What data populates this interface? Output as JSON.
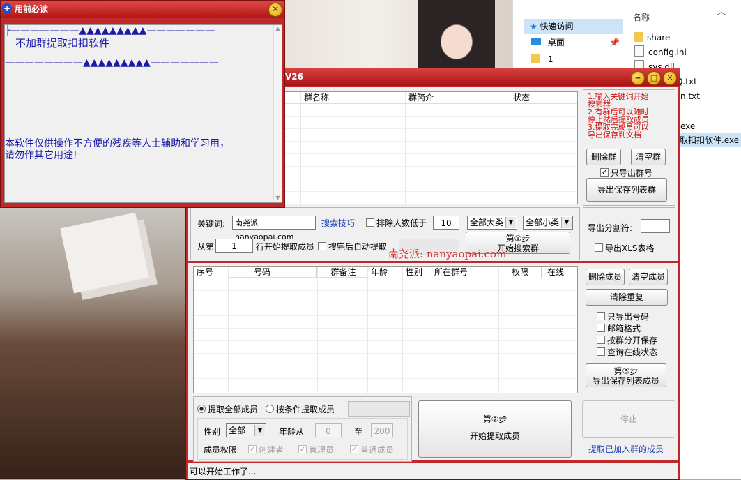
{
  "explorer": {
    "column_header": "名称",
    "quick_access": "快速访问",
    "desktop": "桌面",
    "folder_1": "1",
    "files": [
      "share",
      "config.ini",
      "sys.dll",
      "Q.txt",
      "n.txt",
      "exe",
      "取扣扣软件.exe"
    ]
  },
  "notice": {
    "title": "用前必读",
    "line1": "├———————▲▲▲▲▲▲▲▲▲———————",
    "line2": "不加群提取扣扣软件",
    "line3": "————————▲▲▲▲▲▲▲▲▲———————",
    "line4": "本软件仅供操作不方便的残疾等人士辅助和学习用，",
    "line5": "请勿作其它用途!"
  },
  "main": {
    "title": "V26",
    "group_table": {
      "columns": [
        "群名称",
        "群简介",
        "状态"
      ]
    },
    "instructions": [
      "1.输入关键词开始",
      "搜索群",
      "2.有群后可以随时",
      "停止然后提取成员",
      "3.提取完成员可以",
      "导出保存到文档"
    ],
    "delete_group": "删除群",
    "clear_group": "清空群",
    "only_export_group_id": "只导出群号",
    "export_group_list": "导出保存列表群",
    "keyword_label": "关键词:",
    "keyword_value": "南尧派nanyaopai.com",
    "search_tips": "搜索技巧",
    "exclude_below": "排除人数低于",
    "exclude_value": "10",
    "category_major": "全部大类",
    "category_minor": "全部小类",
    "from_label": "从第",
    "from_value": "1",
    "from_suffix": "行开始提取成员",
    "auto_extract": "搜完后自动提取",
    "watermark": "南尧派: nanyaopai.com",
    "step1_line1": "第①步",
    "step1_line2": "开始搜索群",
    "separator_label": "导出分割符:",
    "separator_value": "——",
    "export_xls": "导出XLS表格",
    "member_table": {
      "columns": [
        "序号",
        "号码",
        "群备注",
        "年龄",
        "性别",
        "所在群号",
        "权限",
        "在线"
      ]
    },
    "delete_member": "删除成员",
    "clear_member": "清空成员",
    "dedupe": "清除重复",
    "opt_only_number": "只导出号码",
    "opt_mail_format": "邮箱格式",
    "opt_split_by_group": "按群分开保存",
    "opt_query_online": "查询在线状态",
    "step3_line1": "第③步",
    "step3_line2": "导出保存列表成员",
    "radio_all": "提取全部成员",
    "radio_conditional": "按条件提取成员",
    "gender_label": "性别",
    "gender_value": "全部",
    "age_from_label": "年龄从",
    "age_from": "0",
    "age_to_label": "至",
    "age_to": "200",
    "perm_label": "成员权限",
    "perm_creator": "创建者",
    "perm_admin": "管理员",
    "perm_normal": "普通成员",
    "step2_line1": "第②步",
    "step2_line2": "开始提取成员",
    "stop": "停止",
    "extract_joined": "提取已加入群的成员",
    "status": "可以开始工作了..."
  }
}
